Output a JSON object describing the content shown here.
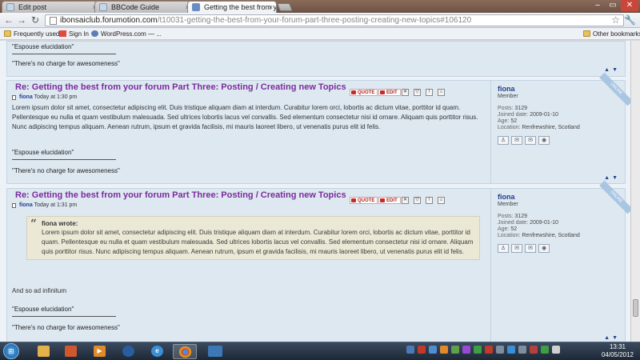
{
  "tabs": [
    {
      "label": "Edit post"
    },
    {
      "label": "BBCode Guide"
    },
    {
      "label": "Getting the best from your"
    }
  ],
  "address": {
    "host": "ibonsaiclub.forumotion.com",
    "path": "/t10031-getting-the-best-from-your-forum-part-three-posting-creating-new-topics#106120"
  },
  "bookmarks": {
    "items": [
      "Frequently used",
      "Sign In",
      "WordPress.com — ..."
    ],
    "other": "Other bookmarks"
  },
  "signature": {
    "line1": "\"Espouse elucidation\"",
    "line2": "\"There's no charge for awesomeness\""
  },
  "posts": [
    {
      "title": "Re: Getting the best from your forum Part Three: Posting / Creating new Topics",
      "author": "fiona",
      "time": "Today at 1:30 pm",
      "body": "Lorem ipsum dolor sit amet, consectetur adipiscing elit. Duis tristique aliquam diam at interdum. Curabitur lorem orci, lobortis ac dictum vitae, porttitor id quam. Pellentesque eu nulla et quam vestibulum malesuada. Sed ultrices lobortis lacus vel convallis. Sed elementum consectetur nisi id ornare. Aliquam quis porttitor risus. Nunc adipiscing tempus aliquam. Aenean rutrum, ipsum et gravida facilisis, mi mauris laoreet libero, ut venenatis purus elit id felis."
    },
    {
      "title": "Re: Getting the best from your forum Part Three: Posting / Creating new Topics",
      "author": "fiona",
      "time": "Today at 1:31 pm",
      "quote_author": "fiona wrote:",
      "quote_body": "Lorem ipsum dolor sit amet, consectetur adipiscing elit. Duis tristique aliquam diam at interdum. Curabitur lorem orci, lobortis ac dictum vitae, porttitor id quam. Pellentesque eu nulla et quam vestibulum malesuada. Sed ultrices lobortis lacus vel convallis. Sed elementum consectetur nisi id ornare. Aliquam quis porttitor risus. Nunc adipiscing tempus aliquam. Aenean rutrum, ipsum et gravida facilisis, mi mauris laoreet libero, ut venenatis purus elit id felis.",
      "body": "And so ad infinitum"
    }
  ],
  "buttons": {
    "quote": "QUOTE",
    "edit": "EDIT"
  },
  "profile": {
    "name": "fiona",
    "rank": "Member",
    "posts_label": "Posts:",
    "posts": "3129",
    "joined_label": "Joined date:",
    "joined": "2009-01-10",
    "age_label": "Age:",
    "age": "52",
    "location_label": "Location:",
    "location": "Renfrewshire, Scotland",
    "badge": "ONLINE"
  },
  "taskbar": {
    "time": "13:31",
    "date": "04/05/2012"
  },
  "colors": {
    "post_title": "#7b2b9c",
    "username": "#24408c",
    "post_bg": "#dde8f1",
    "quote_bg": "#ebe9d6"
  }
}
